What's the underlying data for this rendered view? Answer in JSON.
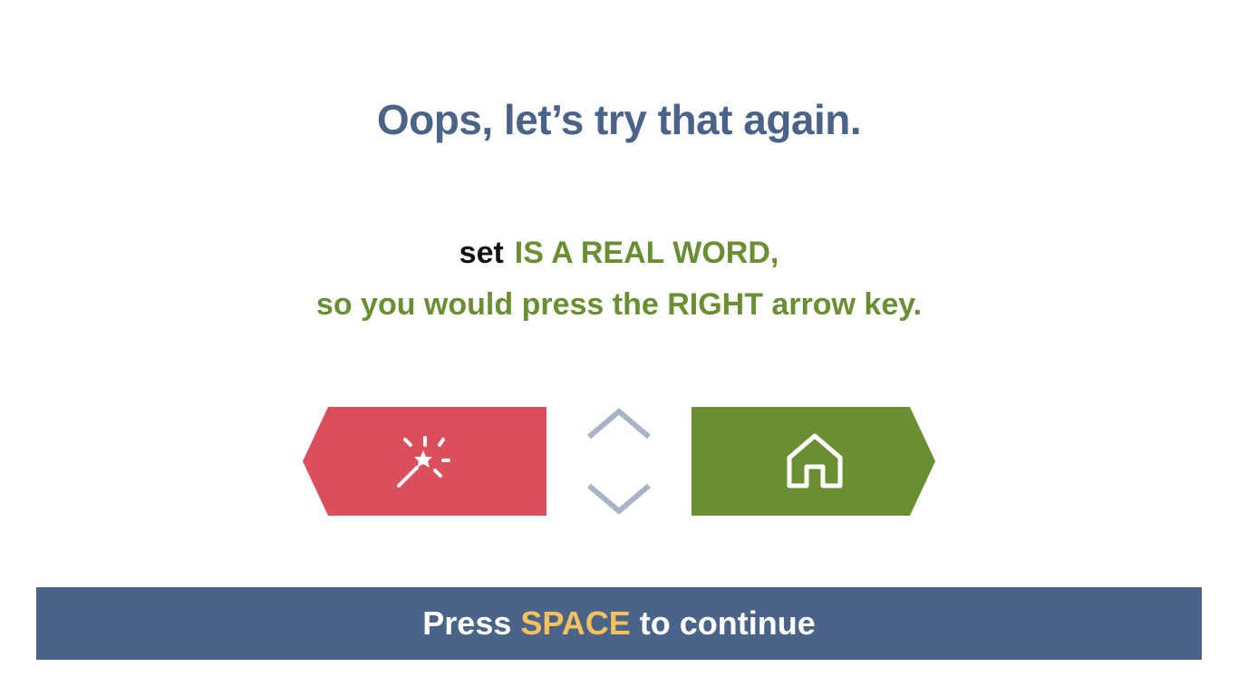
{
  "heading": "Oops, let’s try that again.",
  "feedback": {
    "word": "set",
    "verdict": "IS A REAL WORD,",
    "instruction": "so you would press the RIGHT arrow key."
  },
  "buttons": {
    "left": {
      "icon": "magic-wand-icon",
      "color": "#db4e5c"
    },
    "right": {
      "icon": "home-icon",
      "color": "#6a8f33"
    }
  },
  "footer": {
    "prefix": "Press",
    "key": "SPACE",
    "suffix": "to continue",
    "background": "#4a6389",
    "key_color": "#f6c15b"
  }
}
